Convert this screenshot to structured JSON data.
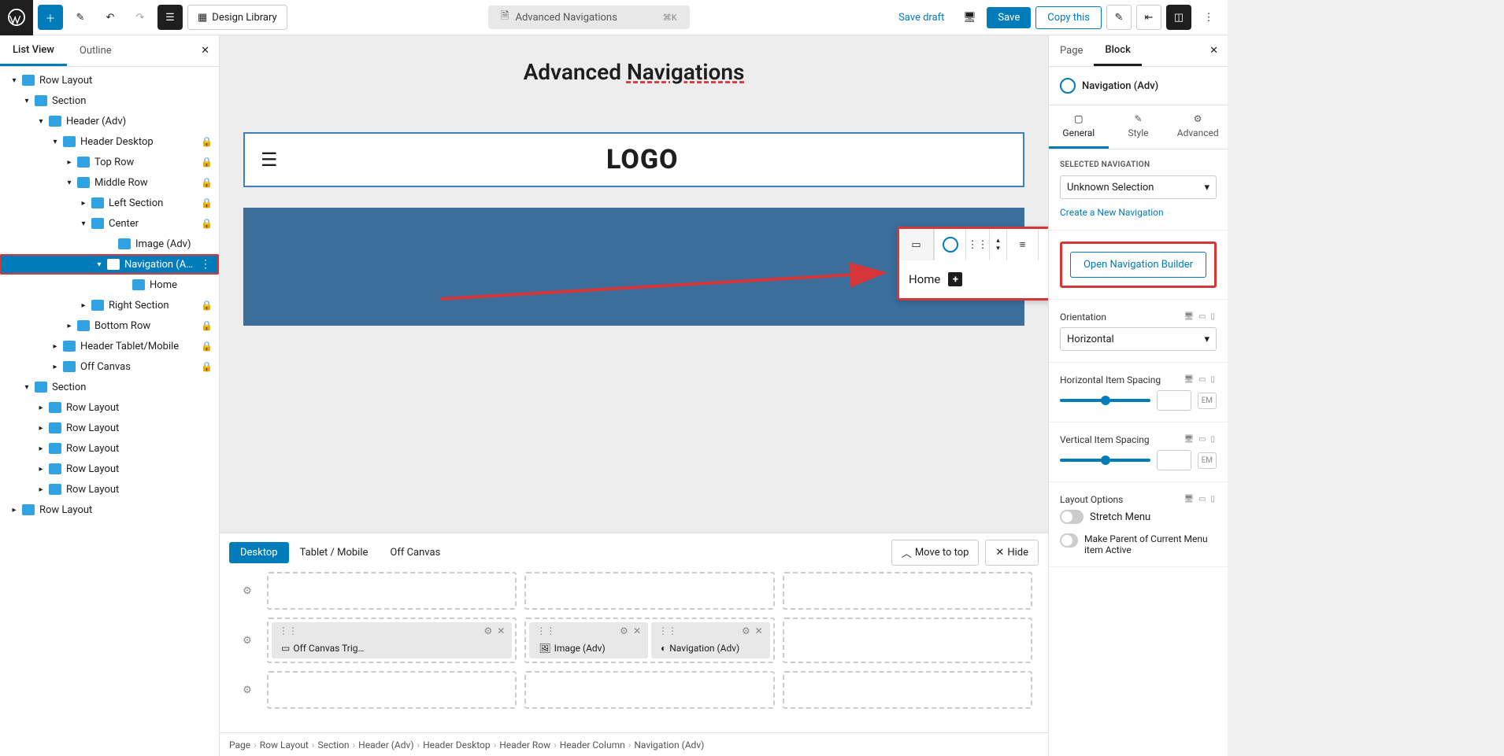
{
  "topbar": {
    "design_library": "Design Library",
    "page_title": "Advanced Navigations",
    "shortcut": "⌘K",
    "save_draft": "Save draft",
    "save": "Save",
    "copy_this": "Copy this"
  },
  "listview": {
    "tab_list": "List View",
    "tab_outline": "Outline",
    "tree": [
      {
        "pad": 8,
        "toggle": "▾",
        "label": "Row Layout"
      },
      {
        "pad": 24,
        "toggle": "▾",
        "label": "Section"
      },
      {
        "pad": 42,
        "toggle": "▾",
        "label": "Header (Adv)"
      },
      {
        "pad": 60,
        "toggle": "▾",
        "label": "Header Desktop",
        "lock": true
      },
      {
        "pad": 78,
        "toggle": "▸",
        "label": "Top Row",
        "lock": true
      },
      {
        "pad": 78,
        "toggle": "▾",
        "label": "Middle Row",
        "lock": true
      },
      {
        "pad": 96,
        "toggle": "▸",
        "label": "Left Section",
        "lock": true
      },
      {
        "pad": 96,
        "toggle": "▾",
        "label": "Center",
        "lock": true
      },
      {
        "pad": 130,
        "toggle": "",
        "label": "Image (Adv)"
      },
      {
        "pad": 114,
        "toggle": "▾",
        "label": "Navigation (Adv)",
        "selected": true,
        "dots": true
      },
      {
        "pad": 148,
        "toggle": "",
        "label": "Home"
      },
      {
        "pad": 96,
        "toggle": "▸",
        "label": "Right Section",
        "lock": true
      },
      {
        "pad": 78,
        "toggle": "▸",
        "label": "Bottom Row",
        "lock": true
      },
      {
        "pad": 60,
        "toggle": "▸",
        "label": "Header Tablet/Mobile",
        "lock": true
      },
      {
        "pad": 60,
        "toggle": "▸",
        "label": "Off Canvas",
        "lock": true
      },
      {
        "pad": 24,
        "toggle": "▾",
        "label": "Section"
      },
      {
        "pad": 42,
        "toggle": "▸",
        "label": "Row Layout"
      },
      {
        "pad": 42,
        "toggle": "▸",
        "label": "Row Layout"
      },
      {
        "pad": 42,
        "toggle": "▸",
        "label": "Row Layout"
      },
      {
        "pad": 42,
        "toggle": "▸",
        "label": "Row Layout"
      },
      {
        "pad": 42,
        "toggle": "▸",
        "label": "Row Layout"
      },
      {
        "pad": 8,
        "toggle": "▸",
        "label": "Row Layout"
      }
    ]
  },
  "canvas": {
    "heading_a": "Advanced ",
    "heading_b": "Navigations",
    "logo": "LOGO",
    "home_label": "Home"
  },
  "bottom": {
    "tabs": [
      "Desktop",
      "Tablet / Mobile",
      "Off Canvas"
    ],
    "move_top": "Move to top",
    "hide": "Hide",
    "chips": {
      "off_canvas": "Off Canvas Trig…",
      "image": "Image (Adv)",
      "nav": "Navigation (Adv)"
    }
  },
  "breadcrumb": [
    "Page",
    "Row Layout",
    "Section",
    "Header (Adv)",
    "Header Desktop",
    "Header Row",
    "Header Column",
    "Navigation (Adv)"
  ],
  "inspector": {
    "tabs": {
      "page": "Page",
      "block": "Block"
    },
    "block_title": "Navigation (Adv)",
    "subtabs": {
      "general": "General",
      "style": "Style",
      "advanced": "Advanced"
    },
    "selected_nav_label": "SELECTED NAVIGATION",
    "selected_nav_value": "Unknown Selection",
    "create_nav": "Create a New Navigation",
    "open_builder": "Open Navigation Builder",
    "orientation_label": "Orientation",
    "orientation_value": "Horizontal",
    "h_spacing": "Horizontal Item Spacing",
    "v_spacing": "Vertical Item Spacing",
    "unit": "EM",
    "layout_options": "Layout Options",
    "stretch": "Stretch Menu",
    "make_parent": "Make Parent of Current Menu item Active"
  }
}
